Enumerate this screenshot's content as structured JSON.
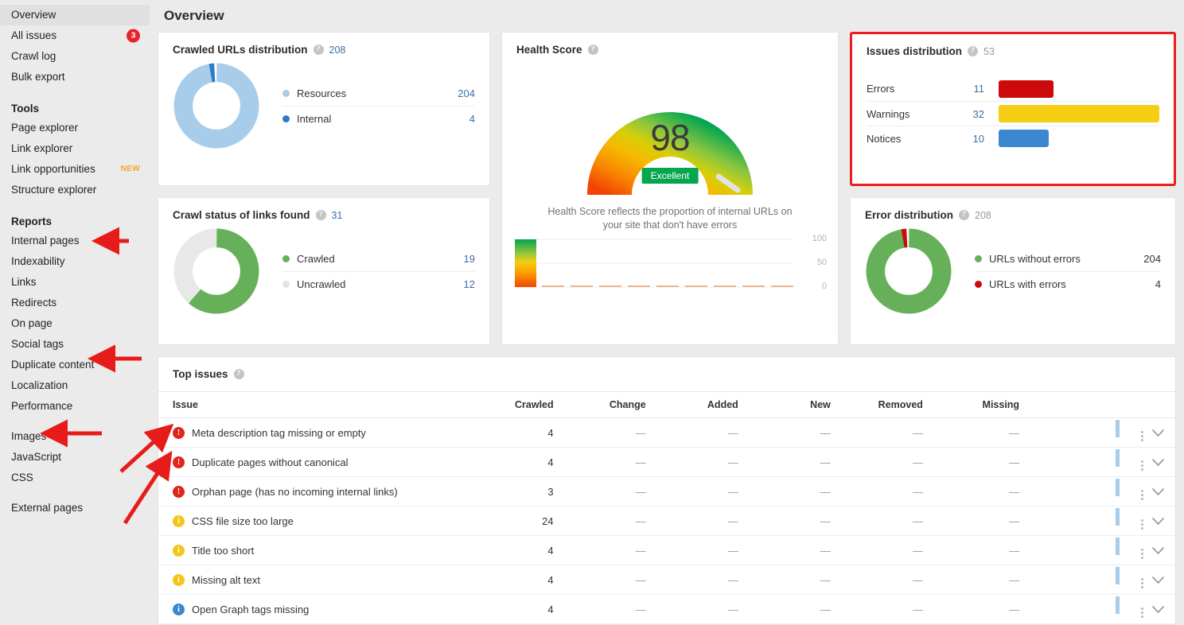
{
  "page": {
    "title": "Overview"
  },
  "sidebar": {
    "top_items": [
      {
        "label": "Overview",
        "active": true
      },
      {
        "label": "All issues",
        "badge": "3"
      },
      {
        "label": "Crawl log"
      },
      {
        "label": "Bulk export"
      }
    ],
    "tools_title": "Tools",
    "tools_items": [
      {
        "label": "Page explorer"
      },
      {
        "label": "Link explorer"
      },
      {
        "label": "Link opportunities",
        "tag": "NEW"
      },
      {
        "label": "Structure explorer"
      }
    ],
    "reports_title": "Reports",
    "reports_items": [
      {
        "label": "Internal pages"
      },
      {
        "label": "Indexability"
      },
      {
        "label": "Links"
      },
      {
        "label": "Redirects"
      },
      {
        "label": "On page"
      },
      {
        "label": "Social tags"
      },
      {
        "label": "Duplicate content"
      },
      {
        "label": "Localization"
      },
      {
        "label": "Performance"
      }
    ],
    "assets_items": [
      {
        "label": "Images"
      },
      {
        "label": "JavaScript"
      },
      {
        "label": "CSS"
      }
    ],
    "external_items": [
      {
        "label": "External pages"
      }
    ]
  },
  "crawled_urls": {
    "title": "Crawled URLs distribution",
    "total": "208",
    "help": "?"
  },
  "crawl_status": {
    "title": "Crawl status of links found",
    "total": "31",
    "help": "?"
  },
  "health": {
    "title": "Health Score",
    "help": "?",
    "score": "98",
    "rating": "Excellent",
    "description": "Health Score reflects the proportion of internal URLs on your site that don't have errors",
    "axis_ticks": [
      "100",
      "50",
      "0"
    ]
  },
  "issues_distribution": {
    "title": "Issues distribution",
    "total": "53",
    "help": "?"
  },
  "error_distribution": {
    "title": "Error distribution",
    "total": "208",
    "help": "?"
  },
  "top_issues": {
    "title": "Top issues",
    "help": "?",
    "columns": [
      "Issue",
      "Crawled",
      "Change",
      "Added",
      "New",
      "Removed",
      "Missing"
    ],
    "rows": [
      {
        "severity": "error",
        "icon": "!",
        "issue": "Meta description tag missing or empty",
        "crawled": "4",
        "change": "—",
        "added": "—",
        "new": "—",
        "removed": "—",
        "missing": "—"
      },
      {
        "severity": "error",
        "icon": "!",
        "issue": "Duplicate pages without canonical",
        "crawled": "4",
        "change": "—",
        "added": "—",
        "new": "—",
        "removed": "—",
        "missing": "—"
      },
      {
        "severity": "error",
        "icon": "!",
        "issue": "Orphan page (has no incoming internal links)",
        "crawled": "3",
        "change": "—",
        "added": "—",
        "new": "—",
        "removed": "—",
        "missing": "—"
      },
      {
        "severity": "warning",
        "icon": "i",
        "issue": "CSS file size too large",
        "crawled": "24",
        "change": "—",
        "added": "—",
        "new": "—",
        "removed": "—",
        "missing": "—"
      },
      {
        "severity": "warning",
        "icon": "i",
        "issue": "Title too short",
        "crawled": "4",
        "change": "—",
        "added": "—",
        "new": "—",
        "removed": "—",
        "missing": "—"
      },
      {
        "severity": "warning",
        "icon": "i",
        "issue": "Missing alt text",
        "crawled": "4",
        "change": "—",
        "added": "—",
        "new": "—",
        "removed": "—",
        "missing": "—"
      },
      {
        "severity": "notice",
        "icon": "i",
        "issue": "Open Graph tags missing",
        "crawled": "4",
        "change": "—",
        "added": "—",
        "new": "—",
        "removed": "—",
        "missing": "—"
      }
    ]
  },
  "chart_data": [
    {
      "type": "pie",
      "title": "Crawled URLs distribution",
      "categories": [
        "Resources",
        "Internal"
      ],
      "values": [
        204,
        4
      ],
      "colors": [
        "#a8cdea",
        "#2c7cc4"
      ],
      "total": 208,
      "legend": "right"
    },
    {
      "type": "pie",
      "title": "Crawl status of links found",
      "categories": [
        "Crawled",
        "Uncrawled"
      ],
      "values": [
        19,
        12
      ],
      "colors": [
        "#67b05a",
        "#e8e8e8"
      ],
      "total": 31,
      "legend": "right"
    },
    {
      "type": "bar",
      "title": "Issues distribution",
      "categories": [
        "Errors",
        "Warnings",
        "Notices"
      ],
      "values": [
        11,
        32,
        10
      ],
      "colors": [
        "#cc0a0a",
        "#f5cd14",
        "#3b88d0"
      ],
      "total": 53,
      "orientation": "horizontal",
      "xlim": [
        0,
        32
      ]
    },
    {
      "type": "pie",
      "title": "Error distribution",
      "categories": [
        "URLs without errors",
        "URLs with errors"
      ],
      "values": [
        204,
        4
      ],
      "colors": [
        "#67b05a",
        "#cc0a0a"
      ],
      "total": 208,
      "legend": "right"
    },
    {
      "type": "gauge",
      "title": "Health Score",
      "value": 98,
      "ylim": [
        0,
        100
      ],
      "rating": "Excellent",
      "gradient": [
        "#f25c05",
        "#f5b700",
        "#8ec63f",
        "#00a651"
      ]
    },
    {
      "type": "line",
      "title": "Health Score history",
      "ylabel": "",
      "ylim": [
        0,
        100
      ],
      "yticks": [
        0,
        50,
        100
      ],
      "values": [
        0,
        0,
        0,
        0,
        0,
        0,
        0,
        0,
        0
      ],
      "grid": true
    }
  ]
}
